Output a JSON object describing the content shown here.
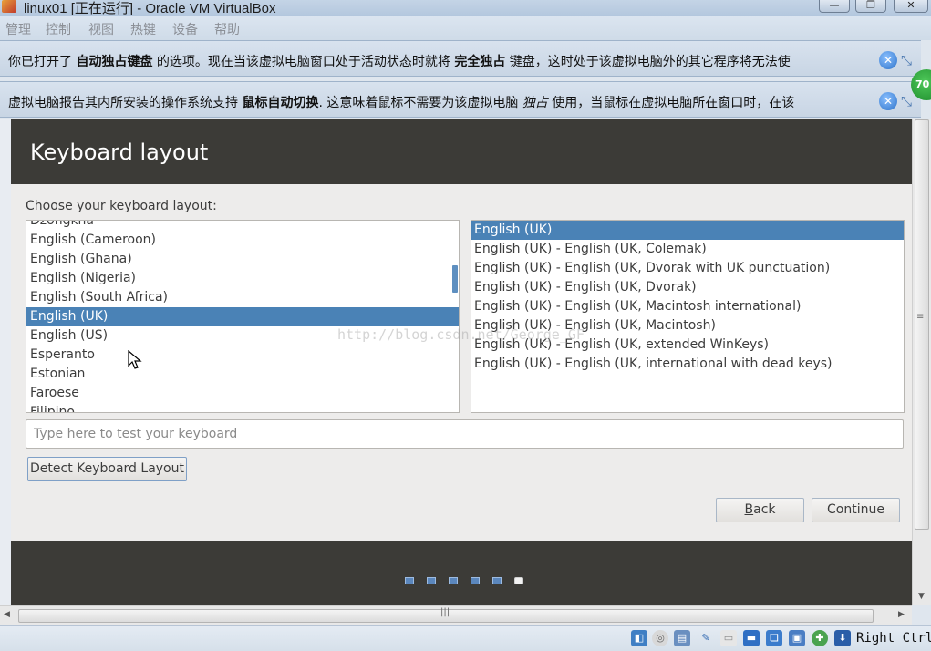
{
  "window": {
    "title": "linux01 [正在运行] - Oracle VM VirtualBox",
    "controls": {
      "minimize": "—",
      "maximize": "❐",
      "close": "✕"
    }
  },
  "menu": [
    "管理",
    "控制",
    "视图",
    "热键",
    "设备",
    "帮助"
  ],
  "notices": {
    "keyboard": {
      "parts": [
        "你已打开了 ",
        "自动独占键盘",
        " 的选项。现在当该虚拟电脑窗口处于活动状态时就将 ",
        "完全独占",
        " 键盘，这时处于该虚拟电脑外的其它程序将无法使"
      ]
    },
    "mouse": {
      "parts": [
        "虚拟电脑报告其内所安装的操作系统支持 ",
        "鼠标自动切换",
        ". 这意味着鼠标不需要为该虚拟电脑 ",
        "独占",
        " 使用，当鼠标在虚拟电脑所在窗口时，在该"
      ]
    },
    "close_glyph": "✕",
    "badge": "70"
  },
  "installer": {
    "header_title": "Keyboard layout",
    "prompt": "Choose your keyboard layout:",
    "layouts": [
      "Dzongkha",
      "English (Cameroon)",
      "English (Ghana)",
      "English (Nigeria)",
      "English (South Africa)",
      "English (UK)",
      "English (US)",
      "Esperanto",
      "Estonian",
      "Faroese",
      "Filipino"
    ],
    "selected_layout": "English (UK)",
    "variants": [
      "English (UK)",
      "English (UK) - English (UK, Colemak)",
      "English (UK) - English (UK, Dvorak with UK punctuation)",
      "English (UK) - English (UK, Dvorak)",
      "English (UK) - English (UK, Macintosh international)",
      "English (UK) - English (UK, Macintosh)",
      "English (UK) - English (UK, extended WinKeys)",
      "English (UK) - English (UK, international with dead keys)"
    ],
    "selected_variant": "English (UK)",
    "test_placeholder": "Type here to test your keyboard",
    "test_value": "",
    "detect_button": "Detect Keyboard Layout",
    "back_button": {
      "mnemonic": "B",
      "rest": "ack"
    },
    "continue_button": "Continue",
    "progress": {
      "total_steps": 6,
      "current_step": 6
    }
  },
  "watermark": "http://blog.csdn.net/George_GF",
  "statusbar": {
    "host_key": "Right Ctrl",
    "icons": [
      "disk-icon",
      "optical-drive-icon",
      "floppy-icon",
      "usb-icon",
      "shared-folder-icon",
      "display-icon",
      "network-icon",
      "capture-icon",
      "cpu-icon",
      "mouse-integration-icon",
      "keyboard-capture-icon"
    ]
  },
  "colors": {
    "selection": "#4a82b6",
    "header_bg": "#3c3b37",
    "progress_dot": "#5b87bd"
  }
}
